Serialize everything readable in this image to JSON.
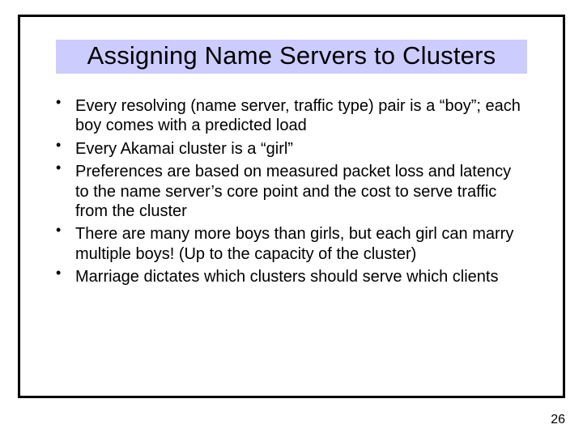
{
  "title": "Assigning Name Servers to Clusters",
  "bullets": [
    "Every resolving (name server, traffic type) pair is a “boy”; each boy comes with a predicted load",
    "Every Akamai cluster is a “girl”",
    "Preferences are based on measured packet loss and latency to the name server’s core point and the cost to serve traffic from the cluster",
    "There are many more boys than girls, but each girl can marry multiple boys!  (Up to the capacity of the cluster)",
    "Marriage dictates which clusters should serve which clients"
  ],
  "page_number": "26"
}
